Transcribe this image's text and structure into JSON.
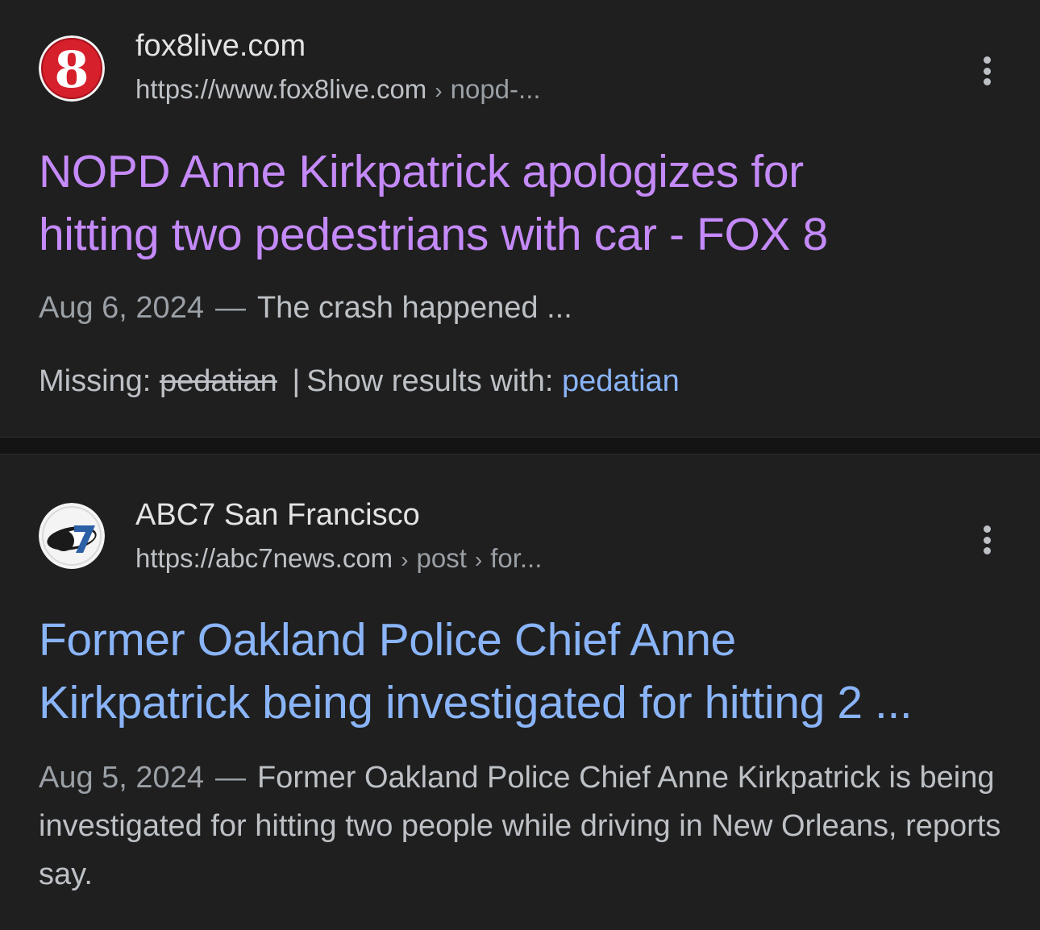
{
  "colors": {
    "background": "#1f1f1f",
    "visited_title": "#c58af9",
    "link_title": "#8ab4f8",
    "snippet_text": "#bdc1c6"
  },
  "results": [
    {
      "site_name": "fox8live.com",
      "url_base": "https://www.fox8live.com",
      "url_crumbs": [
        "nopd-..."
      ],
      "favicon_icon": "fox8-logo-icon",
      "favicon_text": "8",
      "title_lines": [
        "NOPD Anne Kirkpatrick apologizes for",
        "hitting two pedestrians with car - FOX 8"
      ],
      "title_state": "visited",
      "date": "Aug 6, 2024",
      "dash": "—",
      "snippet": "The crash happened ...",
      "missing_label": "Missing:",
      "missing_term": "pedatian",
      "missing_bar": "|",
      "show_results_label": "Show results with:",
      "show_results_term": "pedatian"
    },
    {
      "site_name": "ABC7 San Francisco",
      "url_base": "https://abc7news.com",
      "url_crumbs": [
        "post",
        "for..."
      ],
      "favicon_icon": "abc7-logo-icon",
      "favicon_text": "abc7",
      "title_lines": [
        "Former Oakland Police Chief Anne",
        "Kirkpatrick being investigated for hitting 2 ..."
      ],
      "title_state": "unvisited",
      "date": "Aug 5, 2024",
      "dash": "—",
      "snippet": "Former Oakland Police Chief Anne Kirkpatrick is being investigated for hitting two people while driving in New Orleans, reports say."
    }
  ]
}
